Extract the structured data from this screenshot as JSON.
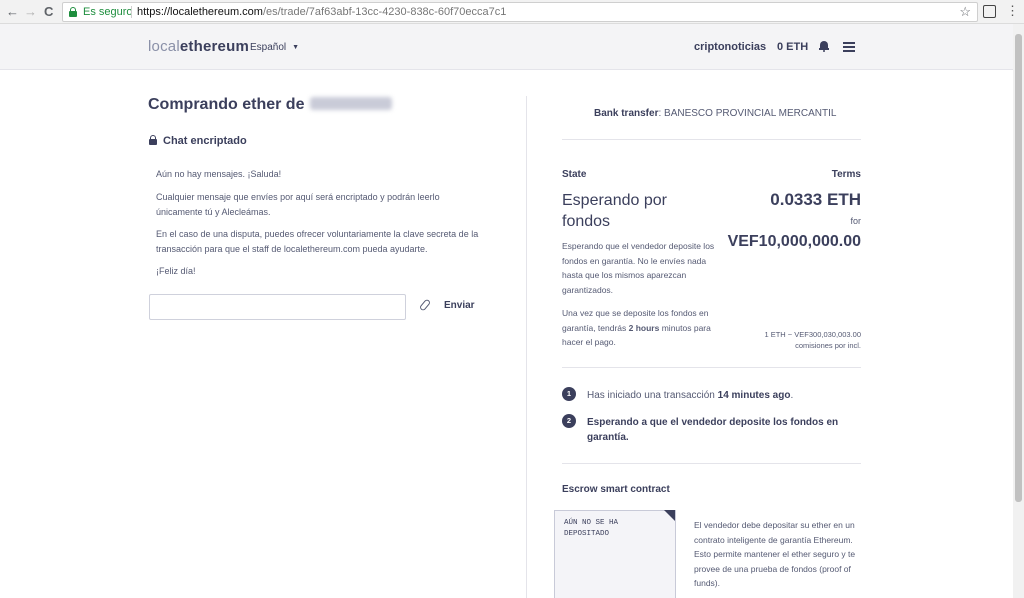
{
  "browser": {
    "secure_label": "Es seguro",
    "url_scheme_host": "https://localethereum.com",
    "url_path": "/es/trade/7af63abf-13cc-4230-838c-60f70ecca7c1",
    "back_glyph": "←",
    "forward_glyph": "→",
    "reload_glyph": "C",
    "star_glyph": "☆",
    "menu_glyph": "⋮"
  },
  "header": {
    "logo_part1": "local",
    "logo_part2": "ethereum",
    "language": "Español",
    "language_caret": "▼",
    "username": "criptonoticias",
    "balance": "0 ETH"
  },
  "trade": {
    "title": "Comprando ether de",
    "chat_heading": "Chat encriptado",
    "messages": [
      "Aún no hay mensajes. ¡Saluda!",
      "Cualquier mensaje que envíes por aquí será encriptado y podrán leerlo únicamente tú y Alecleámas.",
      "En el caso de una disputa, puedes ofrecer voluntariamente la clave secreta de la transacción para que el staff de localethereum.com pueda ayudarte.",
      "¡Feliz día!"
    ],
    "input_placeholder": "",
    "send_label": "Enviar"
  },
  "details": {
    "payment_method_label": "Bank transfer",
    "payment_method_value": ": BANESCO PROVINCIAL MERCANTIL",
    "state_label": "State",
    "terms_label": "Terms",
    "state_value": "Esperando por fondos",
    "state_desc": "Esperando que el vendedor deposite los fondos en garantía. No le envíes nada hasta que los mismos aparezcan garantizados.",
    "payment_window_pre": "Una vez que se deposite los fondos en garantía, tendrás",
    "payment_window_bold": "2 hours",
    "payment_window_post": "minutos para hacer el pago.",
    "amount_eth": "0.0333 ETH",
    "for_label": "for",
    "amount_fiat": "VEF10,000,000.00",
    "rate_line1": "1 ETH ~ VEF300,030,003.00",
    "rate_line2": "comisiones por incl."
  },
  "steps": [
    {
      "num": "1",
      "pre": "Has iniciado una transacción",
      "bold": "14 minutes ago",
      "post": "."
    },
    {
      "num": "2",
      "text": "Esperando a que el vendedor deposite los fondos en garantía."
    }
  ],
  "escrow": {
    "title": "Escrow smart contract",
    "card_text": "AÚN NO SE HA DEPOSITADO",
    "description": "El vendedor debe depositar su ether en un contrato inteligente de garantía Ethereum. Esto permite mantener el ether seguro y te provee de una prueba de fondos (proof of funds)."
  },
  "colors": {
    "primary": "#3b3f5c",
    "muted": "#555a73",
    "header_bg": "#f4f4f6",
    "secure_green": "#1e8e3e"
  }
}
